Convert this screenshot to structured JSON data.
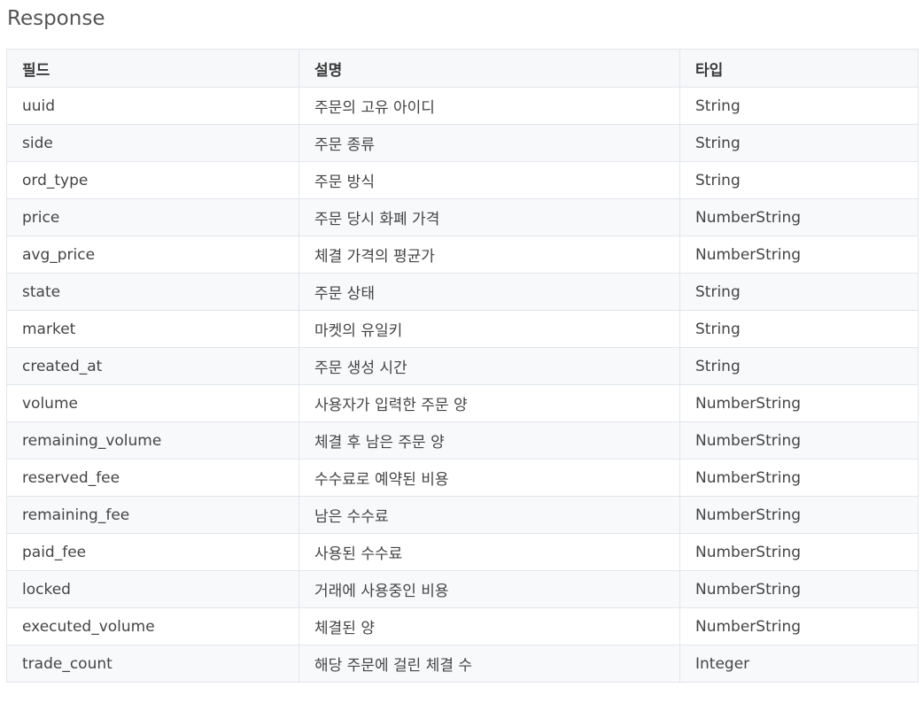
{
  "title": "Response",
  "table": {
    "headers": [
      "필드",
      "설명",
      "타입"
    ],
    "rows": [
      [
        "uuid",
        "주문의 고유 아이디",
        "String"
      ],
      [
        "side",
        "주문 종류",
        "String"
      ],
      [
        "ord_type",
        "주문 방식",
        "String"
      ],
      [
        "price",
        "주문 당시 화폐 가격",
        "NumberString"
      ],
      [
        "avg_price",
        "체결 가격의 평균가",
        "NumberString"
      ],
      [
        "state",
        "주문 상태",
        "String"
      ],
      [
        "market",
        "마켓의 유일키",
        "String"
      ],
      [
        "created_at",
        "주문 생성 시간",
        "String"
      ],
      [
        "volume",
        "사용자가 입력한 주문 양",
        "NumberString"
      ],
      [
        "remaining_volume",
        "체결 후 남은 주문 양",
        "NumberString"
      ],
      [
        "reserved_fee",
        "수수료로 예약된 비용",
        "NumberString"
      ],
      [
        "remaining_fee",
        "남은 수수료",
        "NumberString"
      ],
      [
        "paid_fee",
        "사용된 수수료",
        "NumberString"
      ],
      [
        "locked",
        "거래에 사용중인 비용",
        "NumberString"
      ],
      [
        "executed_volume",
        "체결된 양",
        "NumberString"
      ],
      [
        "trade_count",
        "해당 주문에 걸린 체결 수",
        "Integer"
      ]
    ]
  }
}
